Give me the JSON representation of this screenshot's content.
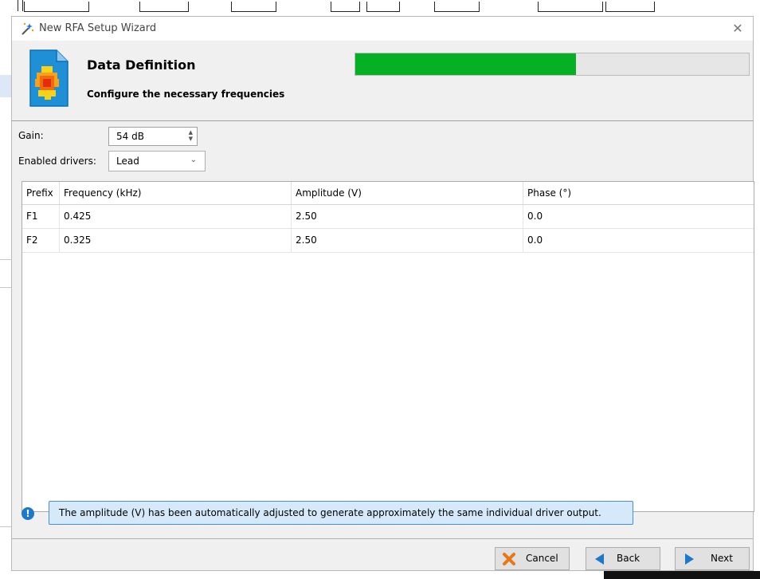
{
  "window": {
    "title": "New RFA Setup Wizard",
    "close_glyph": "✕"
  },
  "header": {
    "title": "Data Definition",
    "subtitle": "Configure the necessary frequencies",
    "progress": 0.56
  },
  "form": {
    "gain_label": "Gain:",
    "gain_value": "54 dB",
    "drivers_label": "Enabled drivers:",
    "drivers_value": "Lead"
  },
  "table": {
    "columns": [
      "Prefix",
      "Frequency (kHz)",
      "Amplitude (V)",
      "Phase (°)"
    ],
    "rows": [
      {
        "prefix": "F1",
        "frequency": "0.425",
        "amplitude": "2.50",
        "phase": "0.0"
      },
      {
        "prefix": "F2",
        "frequency": "0.325",
        "amplitude": "2.50",
        "phase": "0.0"
      }
    ]
  },
  "info": {
    "icon": "!",
    "message": "The amplitude (V) has been automatically adjusted to generate approximately the same individual driver output."
  },
  "buttons": {
    "cancel": "Cancel",
    "back": "Back",
    "next": "Next"
  },
  "colors": {
    "progress": "#06b025",
    "info_bg": "#d6e9fb",
    "accent": "#1c78c8"
  }
}
